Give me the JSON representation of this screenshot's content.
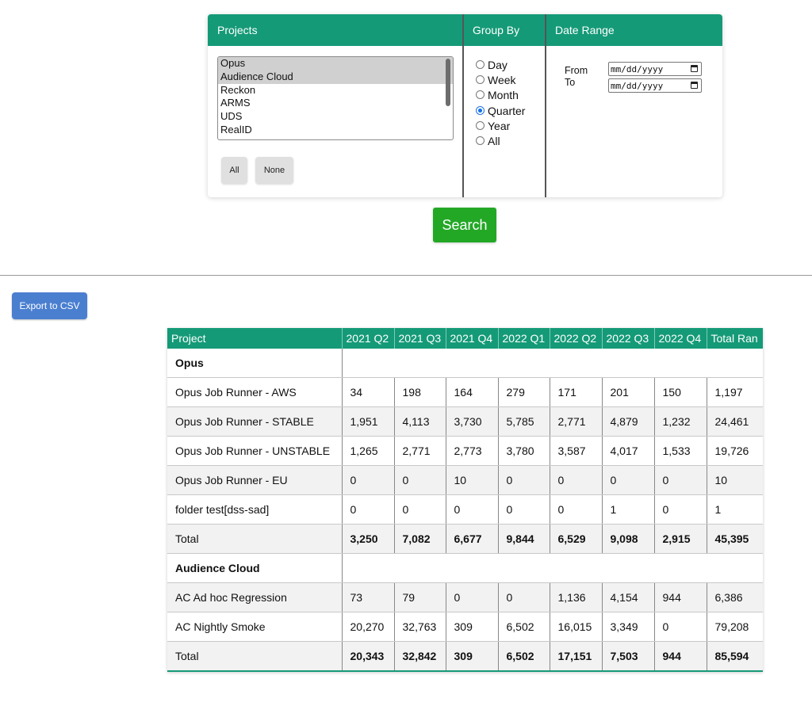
{
  "filters": {
    "projects_header": "Projects",
    "group_by_header": "Group By",
    "date_range_header": "Date Range",
    "projects": [
      {
        "label": "Opus",
        "selected": true
      },
      {
        "label": "Audience Cloud",
        "selected": true
      },
      {
        "label": "Reckon",
        "selected": false
      },
      {
        "label": "ARMS",
        "selected": false
      },
      {
        "label": "UDS",
        "selected": false
      },
      {
        "label": "RealID",
        "selected": false
      }
    ],
    "all_label": "All",
    "none_label": "None",
    "group_options": [
      "Day",
      "Week",
      "Month",
      "Quarter",
      "Year",
      "All"
    ],
    "group_selected": "Quarter",
    "from_label": "From",
    "to_label": "To",
    "from_value": "mm/dd/yyyy",
    "to_value": "mm/dd/yyyy"
  },
  "search_label": "Search",
  "export_label": "Export to CSV",
  "table": {
    "headers": [
      "Project",
      "2021 Q2",
      "2021 Q3",
      "2021 Q4",
      "2022 Q1",
      "2022 Q2",
      "2022 Q3",
      "2022 Q4",
      "Total Ran"
    ],
    "rows": [
      {
        "type": "group",
        "label": "Opus"
      },
      {
        "type": "data",
        "cells": [
          "Opus Job Runner - AWS",
          "34",
          "198",
          "164",
          "279",
          "171",
          "201",
          "150",
          "1,197"
        ]
      },
      {
        "type": "data",
        "cells": [
          "Opus Job Runner - STABLE",
          "1,951",
          "4,113",
          "3,730",
          "5,785",
          "2,771",
          "4,879",
          "1,232",
          "24,461"
        ]
      },
      {
        "type": "data",
        "cells": [
          "Opus Job Runner - UNSTABLE",
          "1,265",
          "2,771",
          "2,773",
          "3,780",
          "3,587",
          "4,017",
          "1,533",
          "19,726"
        ]
      },
      {
        "type": "data",
        "cells": [
          "Opus Job Runner - EU",
          "0",
          "0",
          "10",
          "0",
          "0",
          "0",
          "0",
          "10"
        ]
      },
      {
        "type": "data",
        "cells": [
          "folder test[dss-sad]",
          "0",
          "0",
          "0",
          "0",
          "0",
          "1",
          "0",
          "1"
        ]
      },
      {
        "type": "total",
        "cells": [
          "Total",
          "3,250",
          "7,082",
          "6,677",
          "9,844",
          "6,529",
          "9,098",
          "2,915",
          "45,395"
        ]
      },
      {
        "type": "group",
        "label": "Audience Cloud"
      },
      {
        "type": "data",
        "cells": [
          "AC Ad hoc Regression",
          "73",
          "79",
          "0",
          "0",
          "1,136",
          "4,154",
          "944",
          "6,386"
        ]
      },
      {
        "type": "data",
        "cells": [
          "AC Nightly Smoke",
          "20,270",
          "32,763",
          "309",
          "6,502",
          "16,015",
          "3,349",
          "0",
          "79,208"
        ]
      },
      {
        "type": "total",
        "cells": [
          "Total",
          "20,343",
          "32,842",
          "309",
          "6,502",
          "17,151",
          "7,503",
          "944",
          "85,594"
        ]
      }
    ]
  }
}
